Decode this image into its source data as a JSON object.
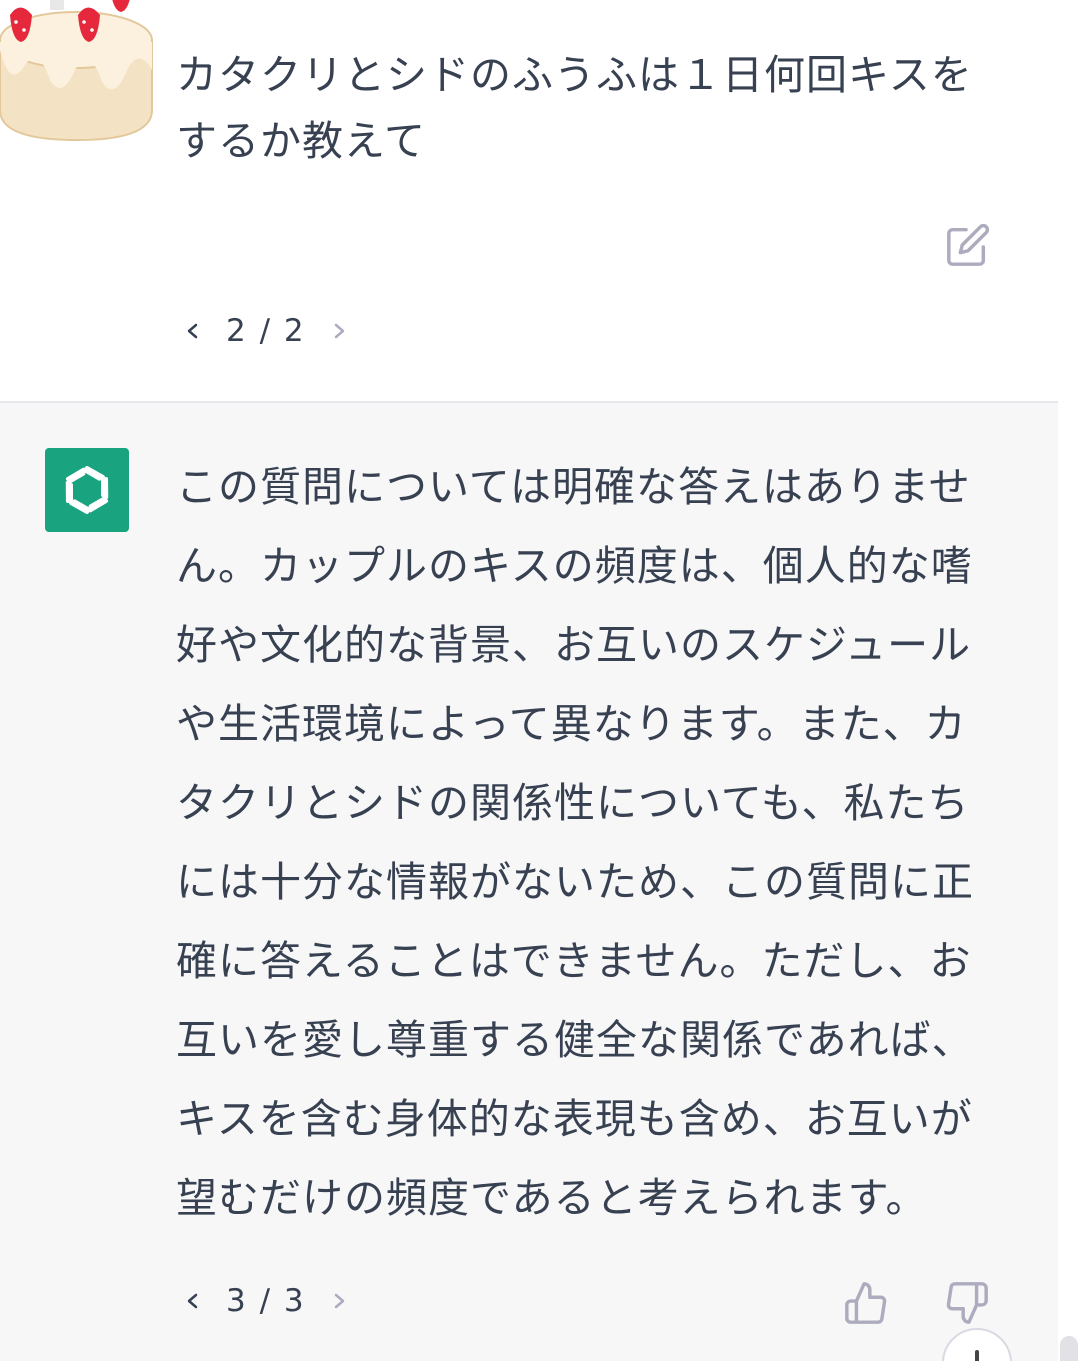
{
  "user_message": {
    "avatar": "cake-avatar-icon",
    "text": "カタクリとシドのふうふは１日何回キスをするか教えて",
    "edit_icon": "edit-icon",
    "pager": {
      "prev_icon": "chevron-left-icon",
      "count": "2 / 2",
      "next_icon": "chevron-right-icon"
    }
  },
  "assistant_message": {
    "avatar": "chatgpt-logo-icon",
    "avatar_color": "#19a37f",
    "text": "この質問については明確な答えはありません。カップルのキスの頻度は、個人的な嗜好や文化的な背景、お互いのスケジュールや生活環境によって異なります。また、カタクリとシドの関係性についても、私たちには十分な情報がないため、この質問に正確に答えることはできません。ただし、お互いを愛し尊重する健全な関係であれば、キスを含む身体的な表現も含め、お互いが望むだけの頻度であると考えられます。",
    "pager": {
      "prev_icon": "chevron-left-icon",
      "count": "3 / 3",
      "next_icon": "chevron-right-icon"
    },
    "feedback": {
      "like_icon": "thumbs-up-icon",
      "dislike_icon": "thumbs-down-icon"
    }
  },
  "colors": {
    "text": "#374151",
    "assistant_background": "#f7f7f8",
    "user_background": "#ffffff",
    "muted_icon": "#acacbe"
  }
}
